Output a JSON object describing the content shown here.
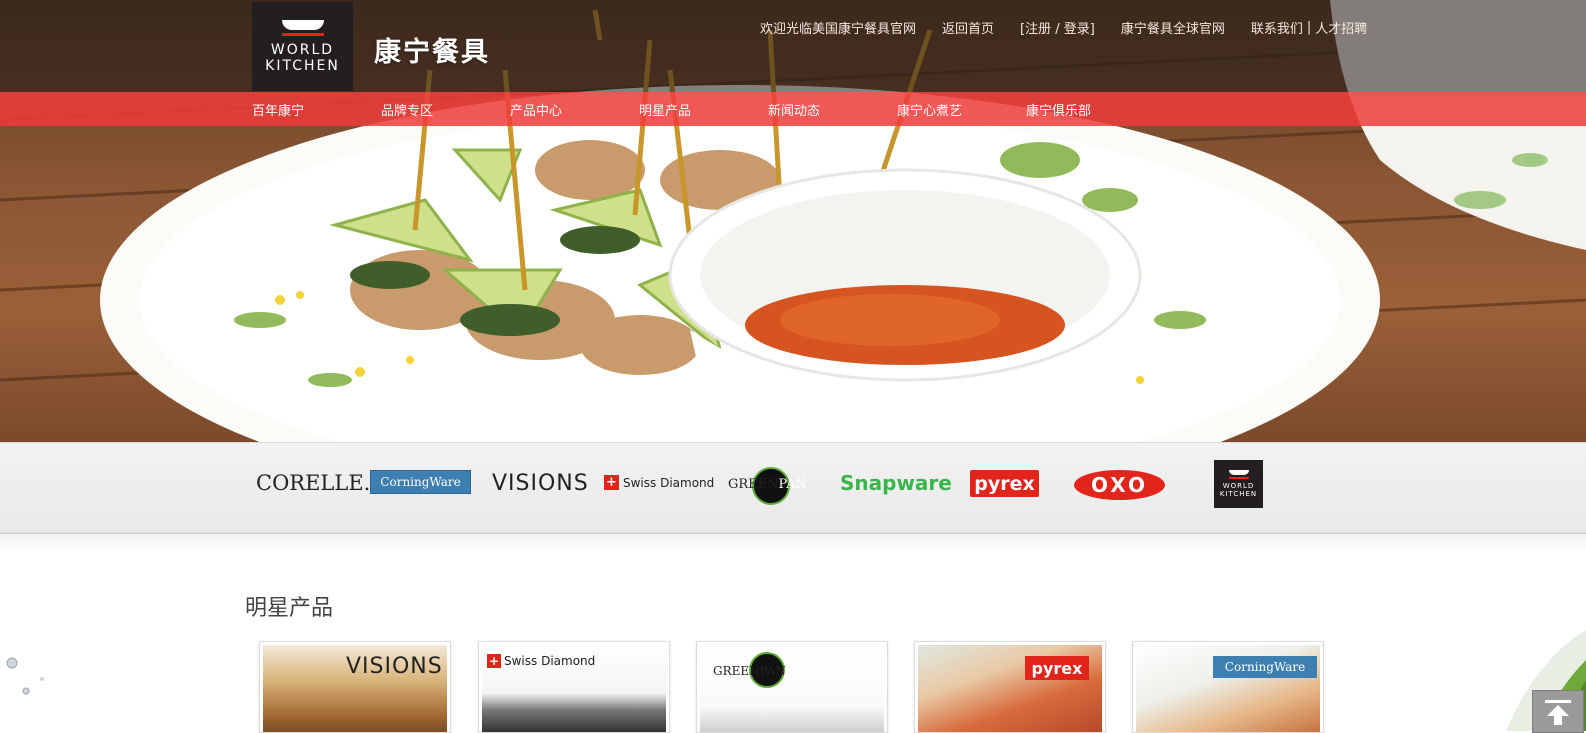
{
  "header": {
    "logo_text_line1": "WORLD",
    "logo_text_line2": "KITCHEN",
    "brand_title": "康宁餐具",
    "welcome": "欢迎光临美国康宁餐具官网",
    "links": [
      {
        "label": "返回首页"
      },
      {
        "label": "[注册 / 登录]"
      },
      {
        "label": "康宁餐具全球官网"
      }
    ],
    "contact": "联系我们",
    "separator": "|",
    "jobs": "人才招聘"
  },
  "nav": {
    "items": [
      "百年康宁",
      "品牌专区",
      "产品中心",
      "明星产品",
      "新闻动态",
      "康宁心煮艺",
      "康宁俱乐部"
    ]
  },
  "brands": {
    "corelle": "CORELLE.",
    "corningware": "CorningWare",
    "visions": "VISIONS",
    "swiss_diamond": "Swiss Diamond",
    "greenpan_a": "GREEN",
    "greenpan_b": "PAN",
    "snapware": "Snapware",
    "pyrex": "pyrex",
    "oxo": "OXO",
    "world_kitchen_1": "WORLD",
    "world_kitchen_2": "KITCHEN"
  },
  "star_products": {
    "title": "明星产品",
    "cards": [
      {
        "brand": "VISIONS"
      },
      {
        "brand": "Swiss Diamond"
      },
      {
        "brand": "GREENPAN"
      },
      {
        "brand": "pyrex"
      },
      {
        "brand": "CorningWare"
      }
    ]
  },
  "colors": {
    "nav_red": "#ed3c3a",
    "brand_red": "#e1251b",
    "corningware_blue": "#3d7fb1",
    "snapware_green": "#3bb54a"
  },
  "icons": {
    "back_to_top": "arrow-up-icon"
  }
}
